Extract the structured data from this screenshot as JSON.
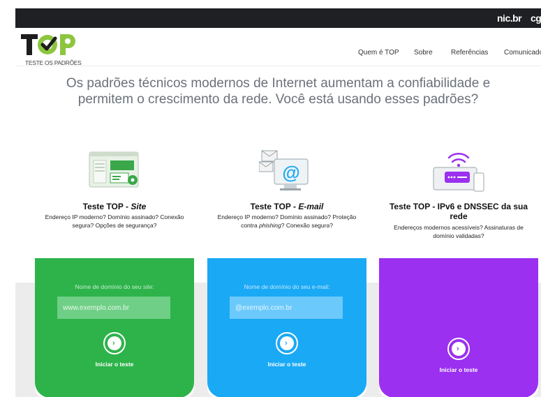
{
  "topbar": {
    "nic_label": "nic.br",
    "cgi_label": "cgi."
  },
  "logo": {
    "text": "TOP",
    "subtitle": "TESTE OS PADRÕES"
  },
  "nav": [
    "Quem é TOP",
    "Sobre",
    "Referências",
    "Comunicado"
  ],
  "hero": {
    "line1": "Os padrões técnicos modernos de Internet aumentam a confiabilidade e",
    "line2": "permitem o crescimento da rede. Você está usando esses padrões?"
  },
  "cards": [
    {
      "title_prefix": "Teste TOP - ",
      "title_em": "Site",
      "desc": "Endereço IP moderno? Domínio assinado? Conexão segura? Opções de segurança?",
      "field_label_prefix": "Nome de domínio do seu ",
      "field_label_em": "site",
      "field_label_suffix": ":",
      "placeholder": "www.exemplo.com.br",
      "button": "Iniciar o teste",
      "color": "#2db34a",
      "input_bg": "#6fcf86",
      "icon": "website-icon"
    },
    {
      "title_prefix": "Teste TOP - ",
      "title_em": "E-mail",
      "desc_1": "Endereço IP moderno? Domínio assinado? Proteção contra ",
      "desc_em": "phishing",
      "desc_2": "? Conexão segura?",
      "field_label": "Nome de domínio do seu e-mail:",
      "placeholder": "@exemplo.com.br",
      "button": "Iniciar o teste",
      "color": "#1aa9f5",
      "input_bg": "#6cc9fb",
      "icon": "email-icon"
    },
    {
      "title": "Teste TOP - IPv6 e DNSSEC da sua rede",
      "desc": "Endereços modernos acessíveis? Assinaturas de domínio validadas?",
      "button": "Iniciar o teste",
      "color": "#9b30f0",
      "icon": "router-wifi-icon"
    }
  ]
}
